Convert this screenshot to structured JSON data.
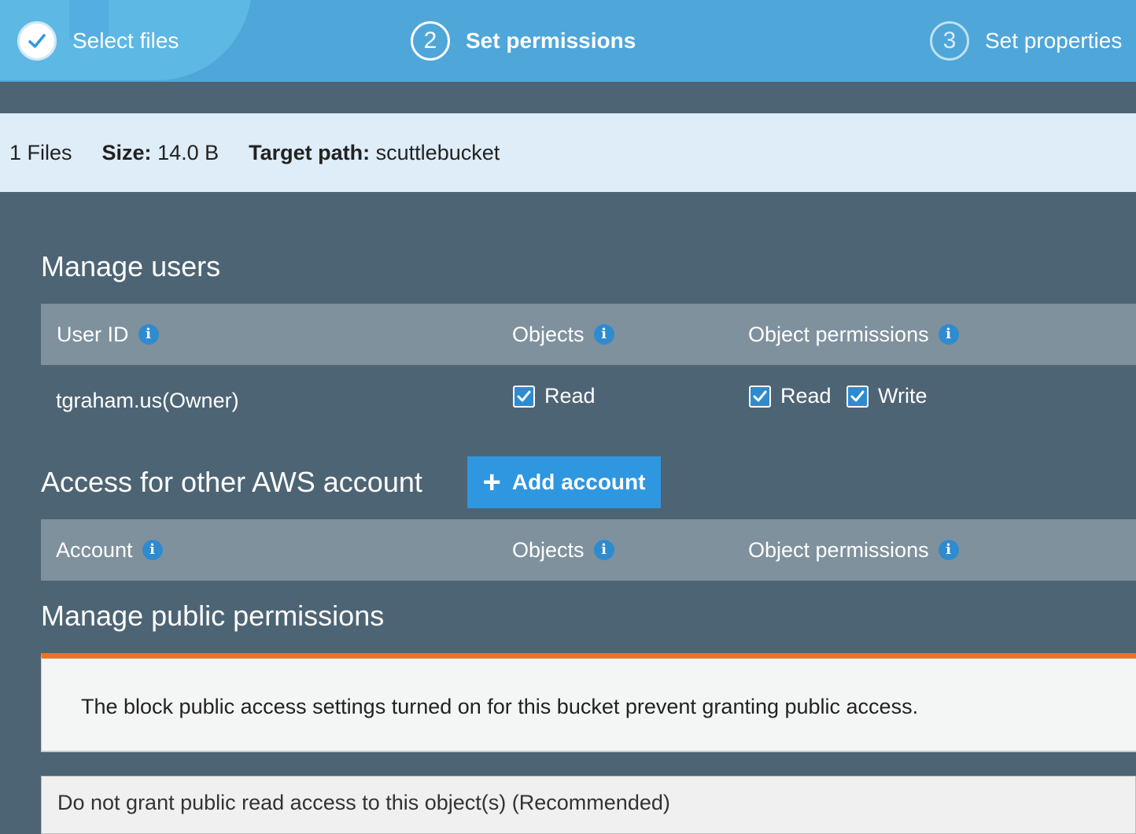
{
  "wizard": {
    "steps": [
      {
        "number": "",
        "label": "Select files",
        "state": "done"
      },
      {
        "number": "2",
        "label": "Set permissions",
        "state": "active"
      },
      {
        "number": "3",
        "label": "Set properties",
        "state": "upcoming"
      }
    ]
  },
  "summary": {
    "files": "1 Files",
    "size_label": "Size:",
    "size_value": "14.0 B",
    "target_label": "Target path:",
    "target_value": "scuttlebucket"
  },
  "manage_users": {
    "title": "Manage users",
    "columns": {
      "user_id": "User ID",
      "objects": "Objects",
      "object_permissions": "Object permissions"
    },
    "rows": [
      {
        "user": "tgraham.us(Owner)",
        "objects_read": {
          "label": "Read",
          "checked": true
        },
        "perm_read": {
          "label": "Read",
          "checked": true
        },
        "perm_write": {
          "label": "Write",
          "checked": true
        }
      }
    ]
  },
  "other_accounts": {
    "title": "Access for other AWS account",
    "add_button": "Add account",
    "columns": {
      "account": "Account",
      "objects": "Objects",
      "object_permissions": "Object permissions"
    }
  },
  "public_permissions": {
    "title": "Manage public permissions",
    "alert": "The block public access settings turned on for this bucket prevent granting public access.",
    "select_value": "Do not grant public read access to this object(s) (Recommended)"
  },
  "colors": {
    "header_blue": "#4fa6d9",
    "page_bg": "#4d6474",
    "accent_blue": "#2f96e0",
    "alert_orange": "#ec7325"
  },
  "icons": {
    "step_done": "check-circle-icon",
    "info": "info-icon",
    "add": "plus-icon",
    "checkbox": "checkbox-checked-icon"
  }
}
